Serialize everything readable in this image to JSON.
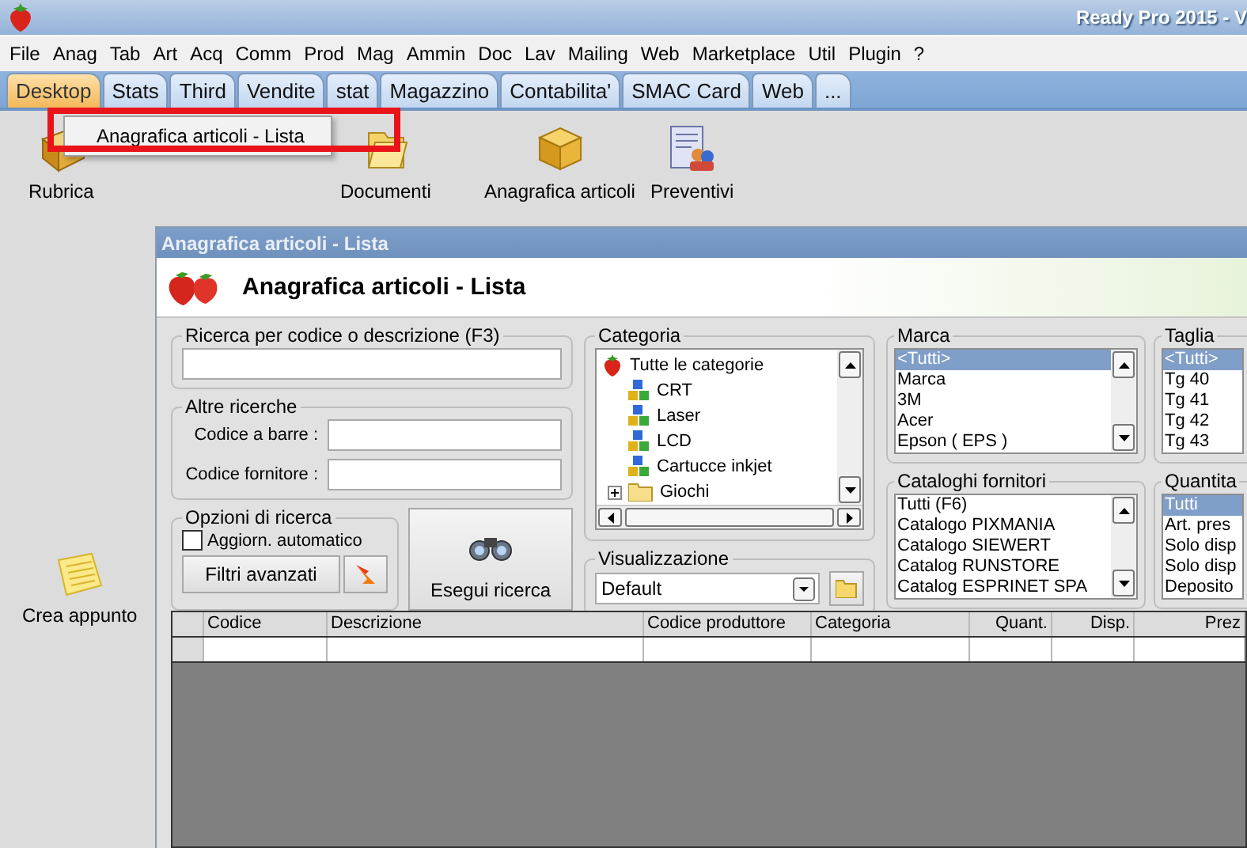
{
  "window": {
    "title": "Ready Pro 2015 - V"
  },
  "menu": [
    "File",
    "Anag",
    "Tab",
    "Art",
    "Acq",
    "Comm",
    "Prod",
    "Mag",
    "Ammin",
    "Doc",
    "Lav",
    "Mailing",
    "Web",
    "Marketplace",
    "Util",
    "Plugin",
    "?"
  ],
  "tabs": [
    {
      "label": "Desktop",
      "selected": true
    },
    {
      "label": "Stats",
      "selected": false
    },
    {
      "label": "Third",
      "selected": false
    },
    {
      "label": "Vendite",
      "selected": false
    },
    {
      "label": "stat",
      "selected": false
    },
    {
      "label": "Magazzino",
      "selected": false
    },
    {
      "label": "Contabilita'",
      "selected": false
    },
    {
      "label": "SMAC Card",
      "selected": false
    },
    {
      "label": "Web",
      "selected": false
    },
    {
      "label": "...",
      "selected": false
    }
  ],
  "popup_menu": {
    "items": [
      "Anagrafica articoli  - Lista"
    ]
  },
  "desktop_icons": [
    {
      "label": "Rubrica",
      "kind": "book"
    },
    {
      "label": "Documenti",
      "kind": "folder"
    },
    {
      "label": "Anagrafica articoli",
      "kind": "box"
    },
    {
      "label": "Preventivi",
      "kind": "quote"
    },
    {
      "label": "Crea appunto",
      "kind": "note"
    }
  ],
  "list_window": {
    "title": "Anagrafica articoli  - Lista",
    "header": "Anagrafica articoli  - Lista",
    "search": {
      "label": "Ricerca per codice o descrizione (F3)"
    },
    "other_search": {
      "label": "Altre ricerche",
      "fields": [
        "Codice a barre :",
        "Codice fornitore :"
      ]
    },
    "options": {
      "label": "Opzioni di ricerca",
      "auto_update": {
        "label": "Aggiorn. automatico",
        "checked": false
      },
      "advanced_button": "Filtri avanzati"
    },
    "search_button": "Esegui ricerca",
    "category": {
      "label": "Categoria",
      "tree": [
        {
          "label": "Tutte le categorie",
          "kind": "root",
          "children": [
            {
              "label": "CRT",
              "kind": "category"
            },
            {
              "label": "Laser",
              "kind": "category"
            },
            {
              "label": "LCD",
              "kind": "category"
            },
            {
              "label": "Cartucce inkjet",
              "kind": "category"
            },
            {
              "label": "Giochi",
              "kind": "folder"
            }
          ]
        }
      ]
    },
    "view": {
      "label": "Visualizzazione",
      "value": "Default"
    },
    "brand": {
      "label": "Marca",
      "items": [
        {
          "label": "<Tutti>",
          "selected": true
        },
        {
          "label": "Marca",
          "selected": false
        },
        {
          "label": "3M",
          "selected": false
        },
        {
          "label": "Acer",
          "selected": false
        },
        {
          "label": "Epson ( EPS )",
          "selected": false
        }
      ]
    },
    "size": {
      "label": "Taglia",
      "items": [
        {
          "label": "<Tutti>",
          "selected": true
        },
        {
          "label": "Tg 40",
          "selected": false
        },
        {
          "label": "Tg 41",
          "selected": false
        },
        {
          "label": "Tg 42",
          "selected": false
        },
        {
          "label": "Tg 43",
          "selected": false
        }
      ]
    },
    "catalogs": {
      "label": "Cataloghi fornitori",
      "items": [
        {
          "label": "Tutti (F6)",
          "selected": false
        },
        {
          "label": "Catalogo PIXMANIA",
          "selected": false
        },
        {
          "label": "Catalogo SIEWERT",
          "selected": false
        },
        {
          "label": "Catalog RUNSTORE",
          "selected": false
        },
        {
          "label": "Catalog ESPRINET SPA",
          "selected": false
        }
      ]
    },
    "quantity": {
      "label": "Quantita",
      "items": [
        {
          "label": "Tutti",
          "selected": true
        },
        {
          "label": "Art. pres",
          "selected": false
        },
        {
          "label": "Solo disp",
          "selected": false
        },
        {
          "label": "Solo disp",
          "selected": false
        },
        {
          "label": "Deposito",
          "selected": false
        }
      ]
    },
    "table": {
      "columns": [
        {
          "label": "Codice",
          "kind": "text"
        },
        {
          "label": "Descrizione",
          "kind": "text"
        },
        {
          "label": "Codice produttore",
          "kind": "text"
        },
        {
          "label": "Categoria",
          "kind": "text"
        },
        {
          "label": "Quant.",
          "kind": "number"
        },
        {
          "label": "Disp.",
          "kind": "number"
        },
        {
          "label": "Prez",
          "kind": "number"
        }
      ]
    }
  }
}
